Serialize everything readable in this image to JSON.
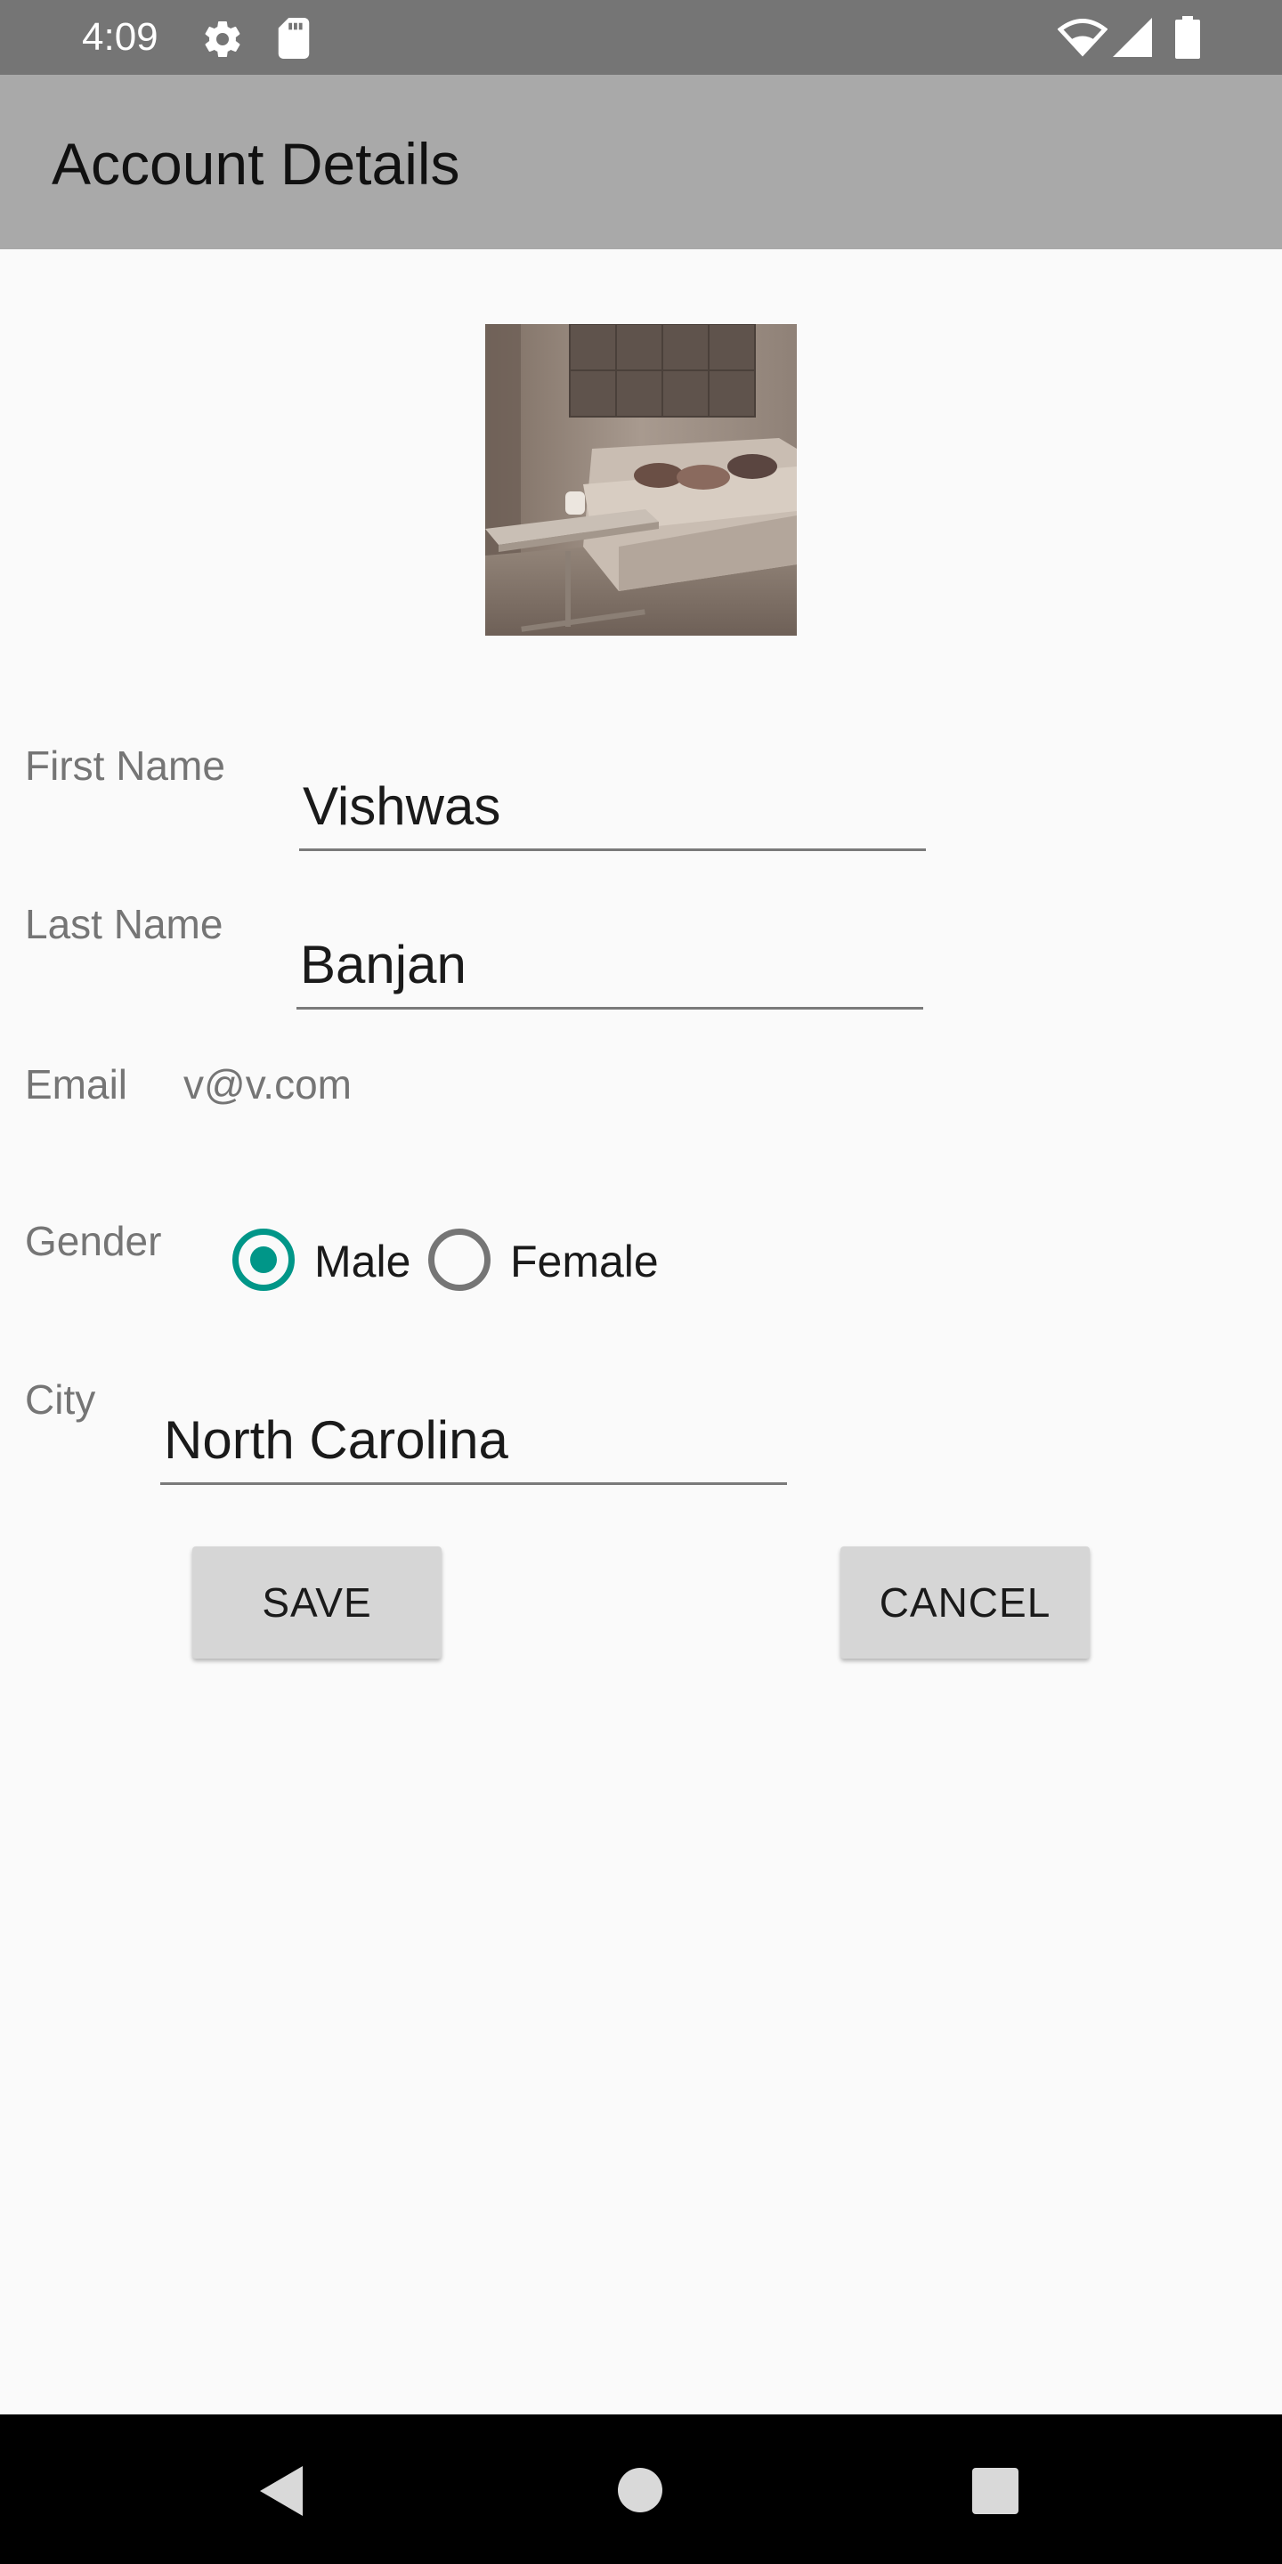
{
  "status_bar": {
    "time": "4:09",
    "icons": [
      "gear-icon",
      "sd-card-icon",
      "wifi-icon",
      "signal-icon",
      "battery-icon"
    ]
  },
  "app_bar": {
    "title": "Account Details"
  },
  "profile": {
    "photo": "living-room-sofa-photo"
  },
  "form": {
    "first_name": {
      "label": "First Name",
      "value": "Vishwas"
    },
    "last_name": {
      "label": "Last Name",
      "value": "Banjan"
    },
    "email": {
      "label": "Email",
      "value": "v@v.com"
    },
    "gender": {
      "label": "Gender",
      "options": [
        {
          "label": "Male",
          "checked": true
        },
        {
          "label": "Female",
          "checked": false
        }
      ]
    },
    "city": {
      "label": "City",
      "value": "North Carolina"
    }
  },
  "buttons": {
    "save_label": "SAVE",
    "cancel_label": "CANCEL"
  },
  "nav_bar": {
    "icons": [
      "back-icon",
      "home-icon",
      "recents-icon"
    ]
  },
  "colors": {
    "status_bar": "#757575",
    "app_bar": "#a9a9a9",
    "accent": "#009688",
    "background": "#fafafa",
    "button": "#d6d6d6"
  }
}
